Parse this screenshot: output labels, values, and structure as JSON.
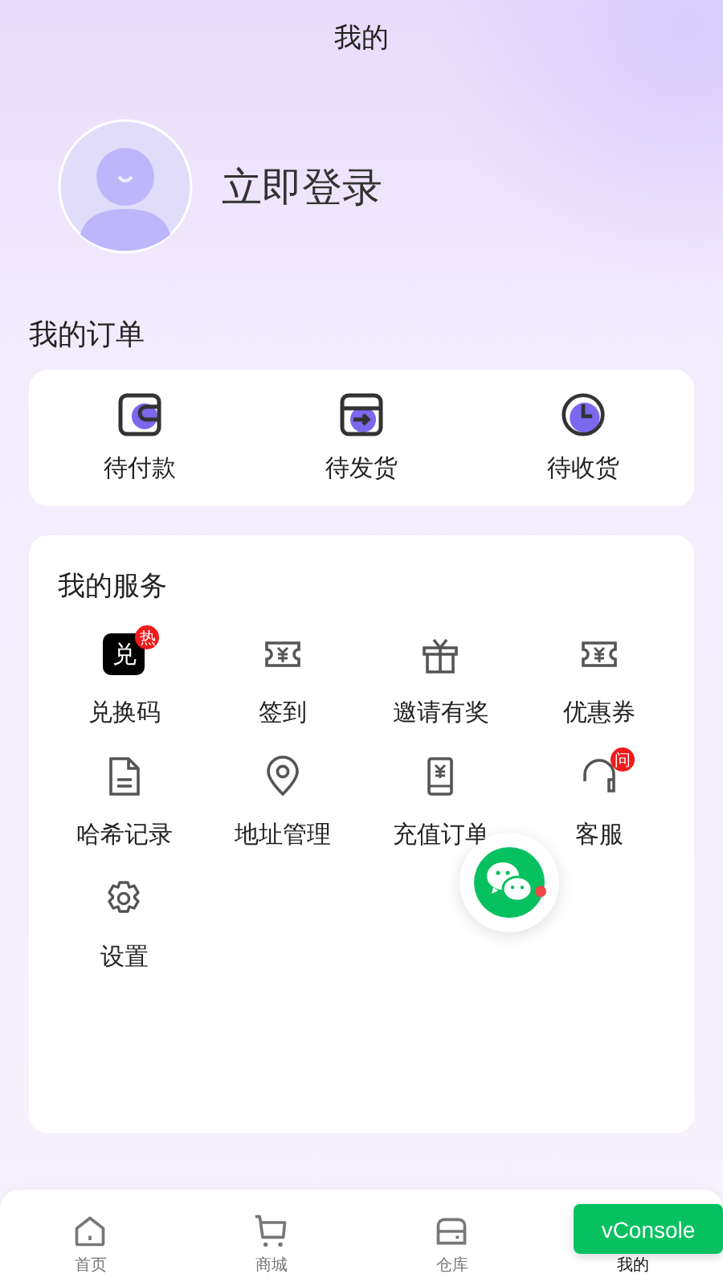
{
  "header": {
    "title": "我的"
  },
  "profile": {
    "login_label": "立即登录"
  },
  "orders": {
    "title": "我的订单",
    "items": [
      {
        "kind": "wallet",
        "label": "待付款"
      },
      {
        "kind": "box",
        "label": "待发货"
      },
      {
        "kind": "clock",
        "label": "待收货"
      }
    ]
  },
  "services": {
    "title": "我的服务",
    "items": [
      {
        "kind": "redeem",
        "label": "兑换码",
        "icon_text": "兑",
        "badge": "热"
      },
      {
        "kind": "ticket",
        "label": "签到"
      },
      {
        "kind": "gift",
        "label": "邀请有奖"
      },
      {
        "kind": "ticket",
        "label": "优惠券"
      },
      {
        "kind": "document",
        "label": "哈希记录"
      },
      {
        "kind": "pin",
        "label": "地址管理"
      },
      {
        "kind": "phone",
        "label": "充值订单"
      },
      {
        "kind": "headset",
        "label": "客服",
        "badge": "问"
      },
      {
        "kind": "gear",
        "label": "设置"
      }
    ]
  },
  "tab_bar": [
    {
      "kind": "home",
      "label": "首页",
      "selected": false
    },
    {
      "kind": "cart",
      "label": "商城",
      "selected": false
    },
    {
      "kind": "drawer",
      "label": "仓库",
      "selected": false
    },
    {
      "label": "我的",
      "selected": true
    }
  ],
  "vconsole_button": "vConsole"
}
